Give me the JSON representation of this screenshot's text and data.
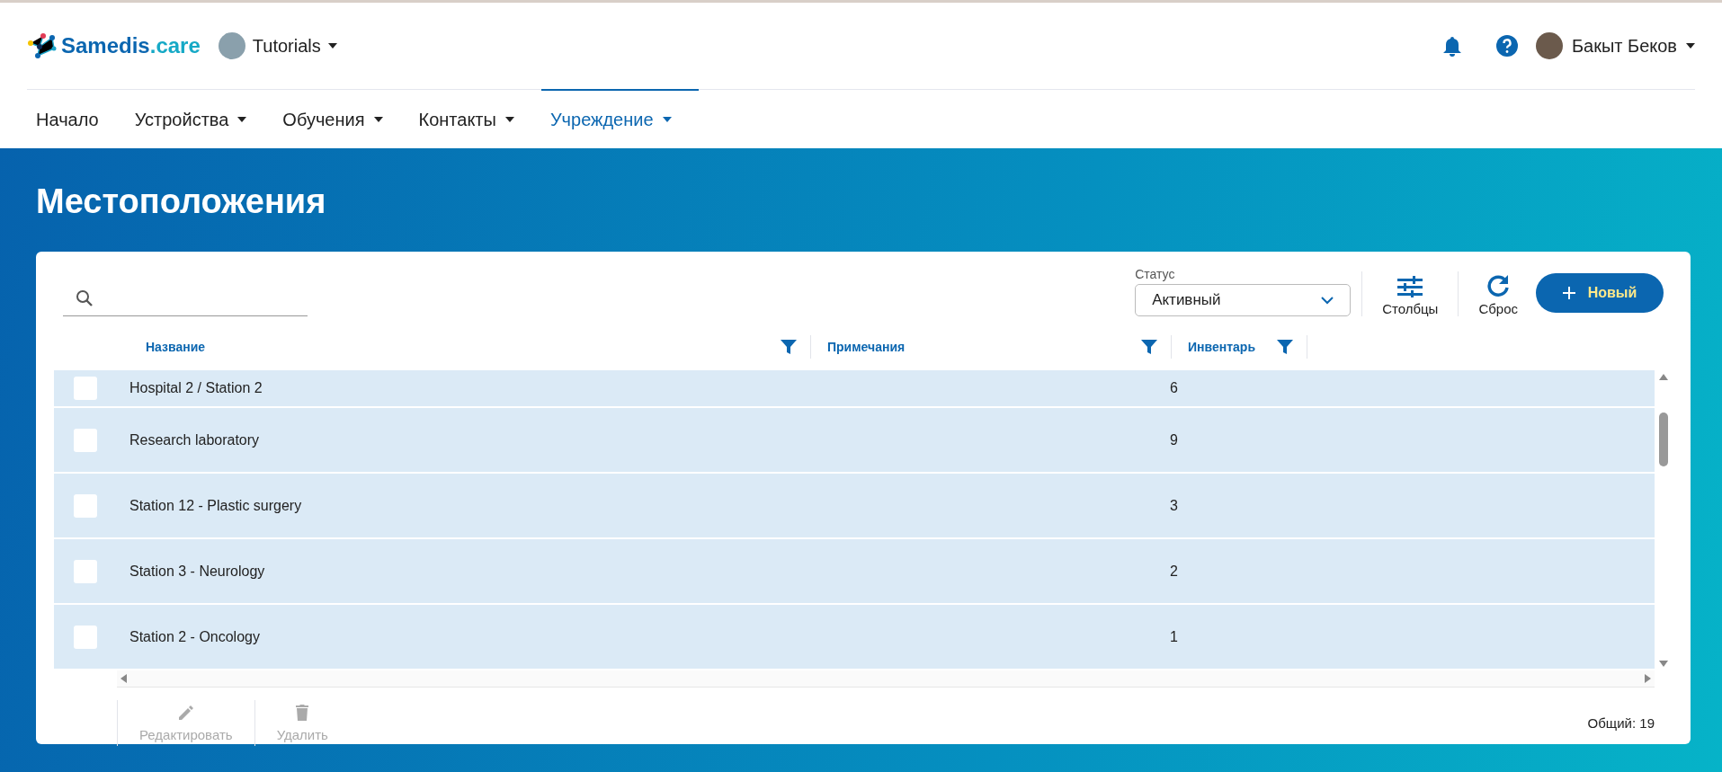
{
  "header": {
    "logo": {
      "name": "Samedis",
      "suffix": ".care"
    },
    "workspace": "Tutorials",
    "user": "Бакыт Беков"
  },
  "nav": [
    {
      "label": "Начало",
      "dropdown": false,
      "selected": false
    },
    {
      "label": "Устройства",
      "dropdown": true,
      "selected": false
    },
    {
      "label": "Обучения",
      "dropdown": true,
      "selected": false
    },
    {
      "label": "Контакты",
      "dropdown": true,
      "selected": false
    },
    {
      "label": "Учреждение",
      "dropdown": true,
      "selected": true
    }
  ],
  "page_title": "Местоположения",
  "toolbar": {
    "status_label": "Статус",
    "status_value": "Активный",
    "columns_button": "Столбцы",
    "reset_button": "Сброс",
    "new_button": "Новый"
  },
  "table": {
    "columns": [
      {
        "label": "Название",
        "filter": true
      },
      {
        "label": "Примечания",
        "filter": true
      },
      {
        "label": "Инвентарь",
        "filter": true
      }
    ],
    "rows": [
      {
        "name": "Hospital 2 / Station 2",
        "inventory": "6",
        "checked": false
      },
      {
        "name": "Research laboratory",
        "inventory": "9",
        "checked": false
      },
      {
        "name": "Station 12 - Plastic surgery",
        "inventory": "3",
        "checked": false
      },
      {
        "name": "Station 3 - Neurology",
        "inventory": "2",
        "checked": false
      },
      {
        "name": "Station 2 - Oncology",
        "inventory": "1",
        "checked": false
      }
    ]
  },
  "footer": {
    "actions": [
      {
        "label": "Редактировать",
        "kind": "edit",
        "disabled": true
      },
      {
        "label": "Удалить",
        "kind": "delete",
        "disabled": true
      }
    ],
    "total": "Общий: 19"
  }
}
